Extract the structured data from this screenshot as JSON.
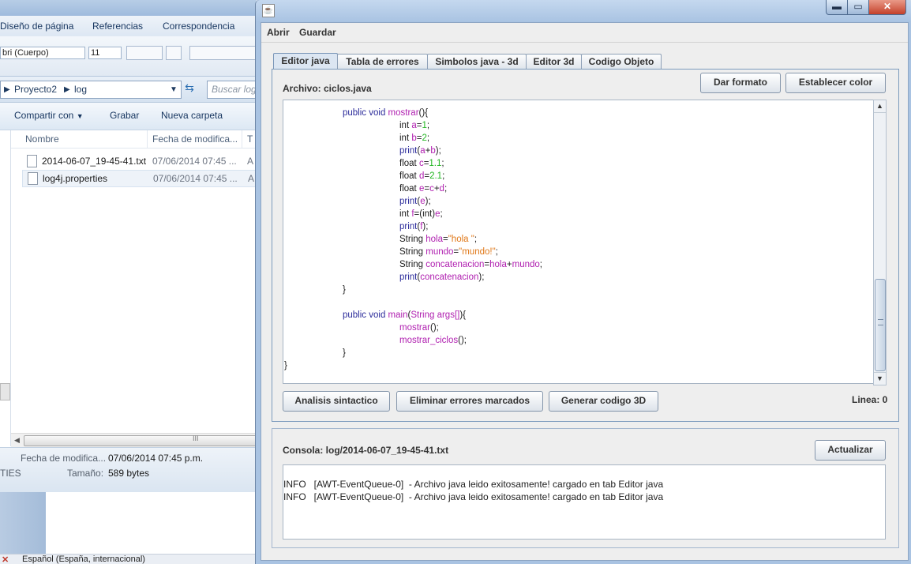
{
  "explorer": {
    "ribbon_tabs": [
      "Diseño de página",
      "Referencias",
      "Correspondencia"
    ],
    "font_name": "bri (Cuerpo)",
    "font_size": "11",
    "breadcrumb": [
      "Proyecto2",
      "log"
    ],
    "search_placeholder": "Buscar log",
    "commands": [
      "Compartir con",
      "Grabar",
      "Nueva carpeta"
    ],
    "columns": [
      "Nombre",
      "Fecha de modifica...",
      "T"
    ],
    "files": [
      {
        "name": "2014-06-07_19-45-41.txt",
        "date": "07/06/2014 07:45 ...",
        "ext": "A"
      },
      {
        "name": "log4j.properties",
        "date": "07/06/2014 07:45 ...",
        "ext": "A"
      }
    ],
    "details": {
      "mod_label": "Fecha de modifica...",
      "mod_value": "07/06/2014 07:45 p.m.",
      "type_short": "TIES",
      "size_label": "Tamaño:",
      "size_value": "589 bytes"
    },
    "language": "Español (España, internacional)"
  },
  "app": {
    "window_controls": {
      "min": "▬",
      "max": "▭",
      "close": "✕"
    },
    "menu": {
      "open": "Abrir",
      "save": "Guardar"
    },
    "tabs": [
      "Editor java",
      "Tabla de errores",
      "Simbolos java - 3d",
      "Editor 3d",
      "Codigo Objeto"
    ],
    "archivo_label": "Archivo: ciclos.java",
    "format_button": "Dar formato",
    "color_button": "Establecer color",
    "code_lines": [
      [
        {
          "t": "public void ",
          "c": "kw"
        },
        {
          "t": "mostrar",
          "c": "id"
        },
        {
          "t": "(){",
          "c": "pl"
        }
      ],
      [
        {
          "t": "int ",
          "c": "pl"
        },
        {
          "t": "a",
          "c": "id"
        },
        {
          "t": "=",
          "c": "pl"
        },
        {
          "t": "1",
          "c": "num"
        },
        {
          "t": ";",
          "c": "pl"
        }
      ],
      [
        {
          "t": "int ",
          "c": "pl"
        },
        {
          "t": "b",
          "c": "id"
        },
        {
          "t": "=",
          "c": "pl"
        },
        {
          "t": "2",
          "c": "num"
        },
        {
          "t": ";",
          "c": "pl"
        }
      ],
      [
        {
          "t": "print",
          "c": "kw"
        },
        {
          "t": "(",
          "c": "pl"
        },
        {
          "t": "a",
          "c": "id"
        },
        {
          "t": "+",
          "c": "pl"
        },
        {
          "t": "b",
          "c": "id"
        },
        {
          "t": ");",
          "c": "pl"
        }
      ],
      [
        {
          "t": "float ",
          "c": "pl"
        },
        {
          "t": "c",
          "c": "id"
        },
        {
          "t": "=",
          "c": "pl"
        },
        {
          "t": "1.1",
          "c": "num"
        },
        {
          "t": ";",
          "c": "pl"
        }
      ],
      [
        {
          "t": "float ",
          "c": "pl"
        },
        {
          "t": "d",
          "c": "id"
        },
        {
          "t": "=",
          "c": "pl"
        },
        {
          "t": "2.1",
          "c": "num"
        },
        {
          "t": ";",
          "c": "pl"
        }
      ],
      [
        {
          "t": "float ",
          "c": "pl"
        },
        {
          "t": "e",
          "c": "id"
        },
        {
          "t": "=",
          "c": "pl"
        },
        {
          "t": "c",
          "c": "id"
        },
        {
          "t": "+",
          "c": "pl"
        },
        {
          "t": "d",
          "c": "id"
        },
        {
          "t": ";",
          "c": "pl"
        }
      ],
      [
        {
          "t": "print",
          "c": "kw"
        },
        {
          "t": "(",
          "c": "pl"
        },
        {
          "t": "e",
          "c": "id"
        },
        {
          "t": ");",
          "c": "pl"
        }
      ],
      [
        {
          "t": "int ",
          "c": "pl"
        },
        {
          "t": "f",
          "c": "id"
        },
        {
          "t": "=(int)",
          "c": "pl"
        },
        {
          "t": "e",
          "c": "id"
        },
        {
          "t": ";",
          "c": "pl"
        }
      ],
      [
        {
          "t": "print",
          "c": "kw"
        },
        {
          "t": "(",
          "c": "pl"
        },
        {
          "t": "f",
          "c": "id"
        },
        {
          "t": ");",
          "c": "pl"
        }
      ],
      [
        {
          "t": "String ",
          "c": "pl"
        },
        {
          "t": "hola",
          "c": "id"
        },
        {
          "t": "=",
          "c": "pl"
        },
        {
          "t": "\"hola \"",
          "c": "str"
        },
        {
          "t": ";",
          "c": "pl"
        }
      ],
      [
        {
          "t": "String ",
          "c": "pl"
        },
        {
          "t": "mundo",
          "c": "id"
        },
        {
          "t": "=",
          "c": "pl"
        },
        {
          "t": "\"mundo!\"",
          "c": "str"
        },
        {
          "t": ";",
          "c": "pl"
        }
      ],
      [
        {
          "t": "String ",
          "c": "pl"
        },
        {
          "t": "concatenacion",
          "c": "id"
        },
        {
          "t": "=",
          "c": "pl"
        },
        {
          "t": "hola",
          "c": "id"
        },
        {
          "t": "+",
          "c": "pl"
        },
        {
          "t": "mundo",
          "c": "id"
        },
        {
          "t": ";",
          "c": "pl"
        }
      ],
      [
        {
          "t": "print",
          "c": "kw"
        },
        {
          "t": "(",
          "c": "pl"
        },
        {
          "t": "concatenacion",
          "c": "id"
        },
        {
          "t": ");",
          "c": "pl"
        }
      ],
      [
        {
          "t": "}",
          "c": "pl"
        }
      ],
      [],
      [
        {
          "t": "public void ",
          "c": "kw"
        },
        {
          "t": "main",
          "c": "id"
        },
        {
          "t": "(",
          "c": "pl"
        },
        {
          "t": "String ",
          "c": "id"
        },
        {
          "t": "args[]",
          "c": "id"
        },
        {
          "t": "){",
          "c": "pl"
        }
      ],
      [
        {
          "t": "mostrar",
          "c": "id"
        },
        {
          "t": "();",
          "c": "pl"
        }
      ],
      [
        {
          "t": "mostrar_ciclos",
          "c": "id"
        },
        {
          "t": "();",
          "c": "pl"
        }
      ],
      [
        {
          "t": "}",
          "c": "pl"
        }
      ],
      [
        {
          "t": "}",
          "c": "pl"
        }
      ]
    ],
    "buttons": {
      "syntax": "Analisis sintactico",
      "clear_errors": "Eliminar errores marcados",
      "gen3d": "Generar codigo 3D"
    },
    "line_label": "Linea: 0",
    "console_label": "Consola: log/2014-06-07_19-45-41.txt",
    "refresh_button": "Actualizar",
    "console_lines": [
      "INFO   [AWT-EventQueue-0]  - Archivo java leido exitosamente! cargado en tab Editor java",
      "INFO   [AWT-EventQueue-0]  - Archivo java leido exitosamente! cargado en tab Editor java"
    ]
  }
}
